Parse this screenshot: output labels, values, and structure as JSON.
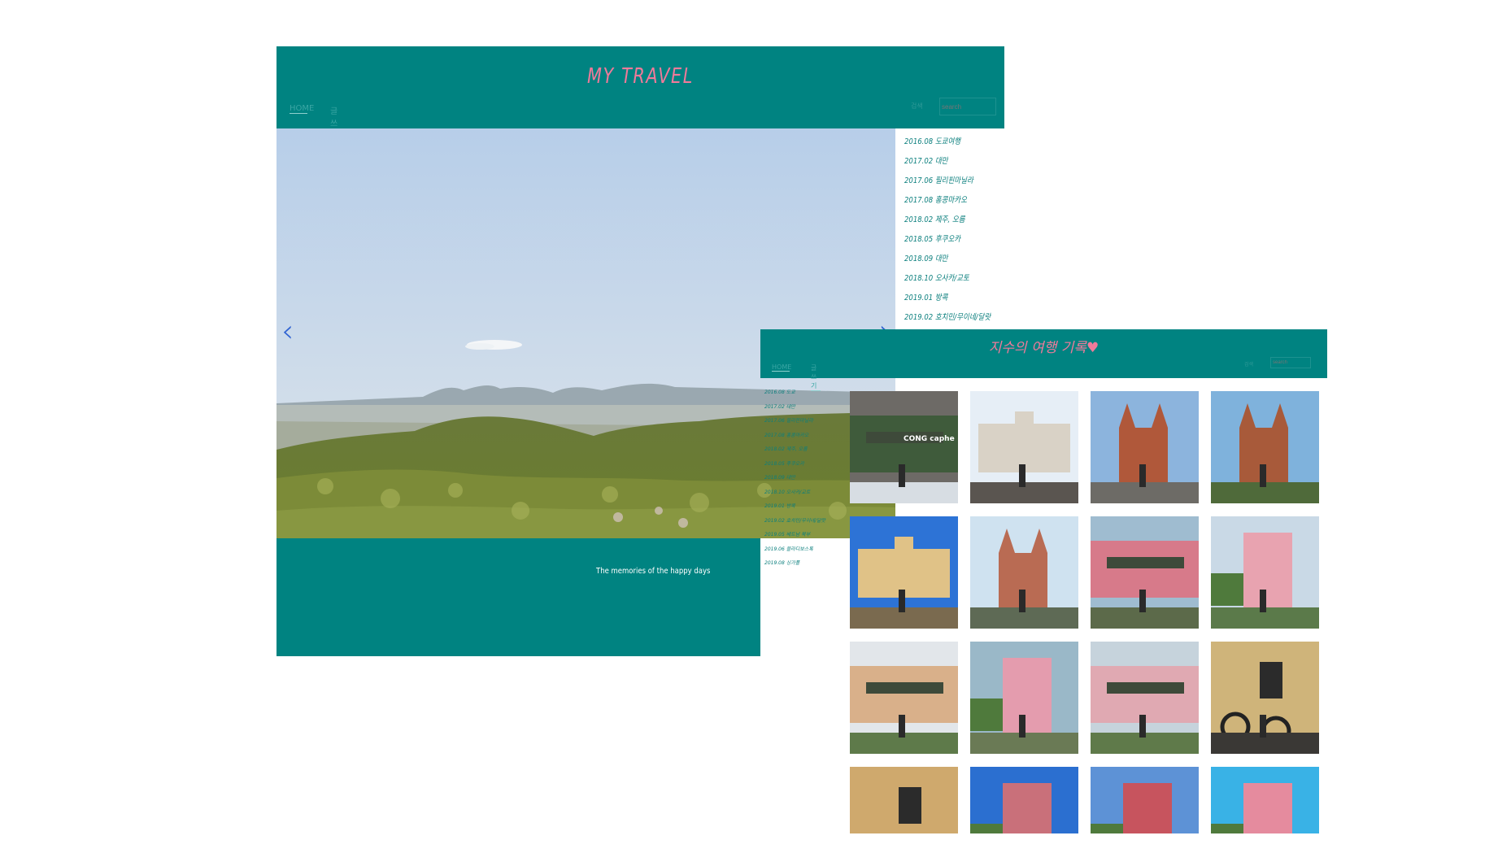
{
  "main_window": {
    "title": "MY TRAVEL",
    "nav": [
      "HOME",
      "글쓰기"
    ],
    "search_label": "검색",
    "search_placeholder": "search",
    "caption": "The memories of the happy days",
    "prev_icon": "chevron-left-icon",
    "next_icon": "chevron-right-icon",
    "trip_list": [
      "2016.08 도쿄여행",
      "2017.02 대만",
      "2017.06 필리핀마닐라",
      "2017.08 홍콩마카오",
      "2018.02 제주, 오름",
      "2018.05 후쿠오카",
      "2018.09 대만",
      "2018.10 오사카/교토",
      "2019.01 방콕",
      "2019.02 호치민/무이네/달랏"
    ]
  },
  "gallery_window": {
    "title": "지수의 여행 기록♥",
    "nav": [
      "HOME",
      "글쓰기"
    ],
    "search_label": "검색",
    "search_placeholder": "search",
    "trip_list": [
      "2016.08 도쿄",
      "2017.02 대만",
      "2017.06 필리핀마닐라",
      "2017.08 홍콩마카오",
      "2018.02 제주, 오름",
      "2018.05 후쿠오카",
      "2018.09 대만",
      "2018.10 오사카/교토",
      "2019.01 방콕",
      "2019.02 호치민/무이네/달랏",
      "2019.05 베트남 북부",
      "2019.06 블라디보스톡",
      "2019.08 싱가폴"
    ],
    "photos": [
      {
        "label": "CONG caphe"
      },
      {
        "label": ""
      },
      {
        "label": ""
      },
      {
        "label": ""
      },
      {
        "label": ""
      },
      {
        "label": ""
      },
      {
        "label": ""
      },
      {
        "label": ""
      },
      {
        "label": ""
      },
      {
        "label": ""
      },
      {
        "label": ""
      },
      {
        "label": ""
      },
      {
        "label": ""
      },
      {
        "label": ""
      },
      {
        "label": ""
      },
      {
        "label": ""
      }
    ]
  },
  "colors": {
    "teal": "#008381",
    "pink_title": "#f07a9a",
    "list_text": "#0b7f7d",
    "arrow": "#2e62d2"
  }
}
